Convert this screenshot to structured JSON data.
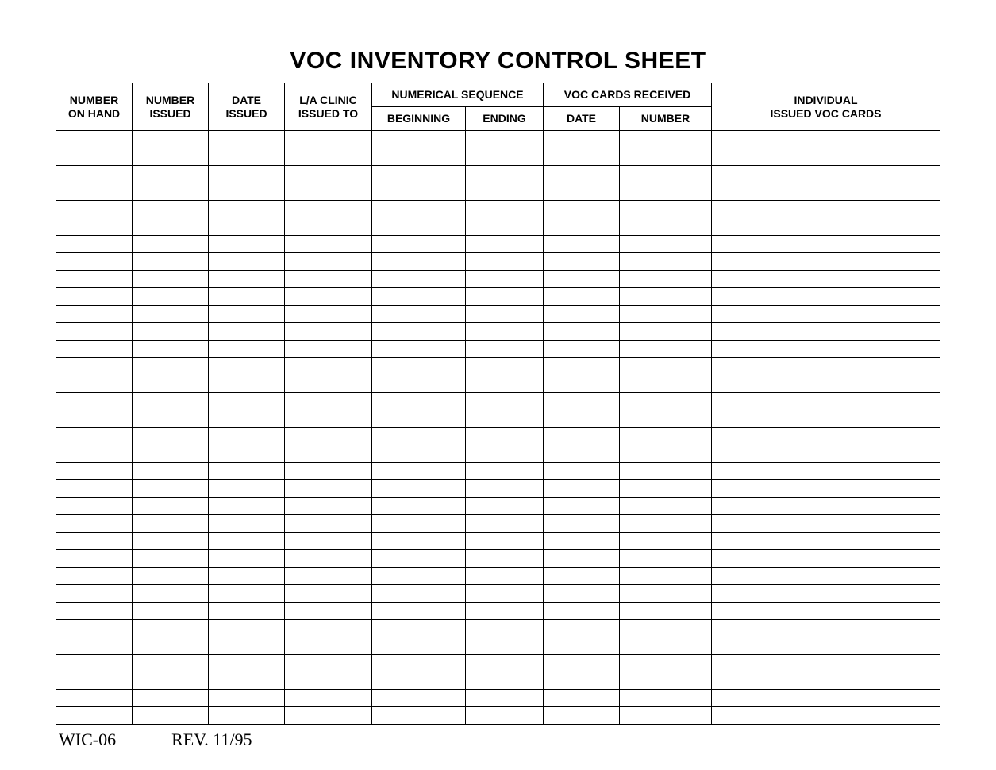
{
  "title": "VOC INVENTORY CONTROL SHEET",
  "headers": {
    "col1_line1": "NUMBER",
    "col1_line2": "ON HAND",
    "col2_line1": "NUMBER",
    "col2_line2": "ISSUED",
    "col3_line1": "DATE",
    "col3_line2": "ISSUED",
    "col4_line1": "L/A CLINIC",
    "col4_line2": "ISSUED TO",
    "group1": "NUMERICAL SEQUENCE",
    "group1_sub1": "BEGINNING",
    "group1_sub2": "ENDING",
    "group2": "VOC CARDS RECEIVED",
    "group2_sub1": "DATE",
    "group2_sub2": "NUMBER",
    "col9_line1": "INDIVIDUAL",
    "col9_line2": "ISSUED VOC CARDS"
  },
  "row_count": 34,
  "footer": {
    "form_id": "WIC-06",
    "revision": "REV. 11/95"
  }
}
